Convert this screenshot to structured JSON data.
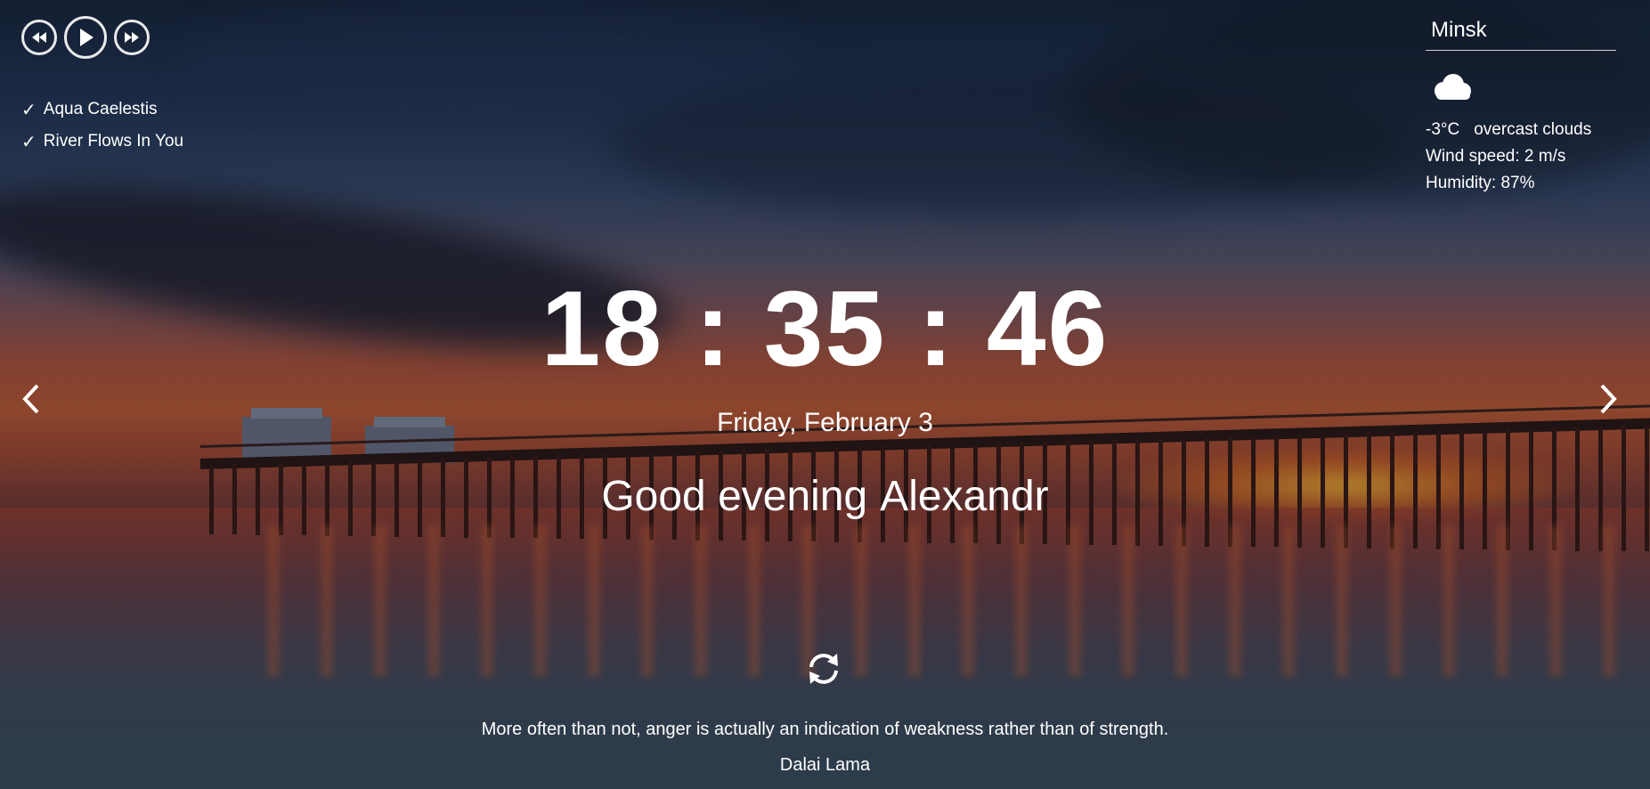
{
  "player": {
    "prev_icon": "rewind-icon",
    "play_icon": "play-icon",
    "next_icon": "fast-forward-icon"
  },
  "playlist": {
    "check_icon": "checkmark-icon",
    "items": [
      {
        "title": "Aqua Caelestis"
      },
      {
        "title": "River Flows In You"
      }
    ]
  },
  "weather": {
    "city": "Minsk",
    "icon": "cloud-icon",
    "temperature": "-3°C",
    "description": "overcast clouds",
    "wind": "Wind speed: 2 m/s",
    "humidity": "Humidity: 87%"
  },
  "slider": {
    "prev_icon": "chevron-left-icon",
    "next_icon": "chevron-right-icon"
  },
  "clock": {
    "time": "18 : 35 : 46",
    "date": "Friday, February 3"
  },
  "greeting": {
    "text": "Good evening",
    "name": "Alexandr"
  },
  "quote": {
    "refresh_icon": "refresh-icon",
    "text": "More often than not, anger is actually an indication of weakness rather than of strength.",
    "author": "Dalai Lama"
  }
}
